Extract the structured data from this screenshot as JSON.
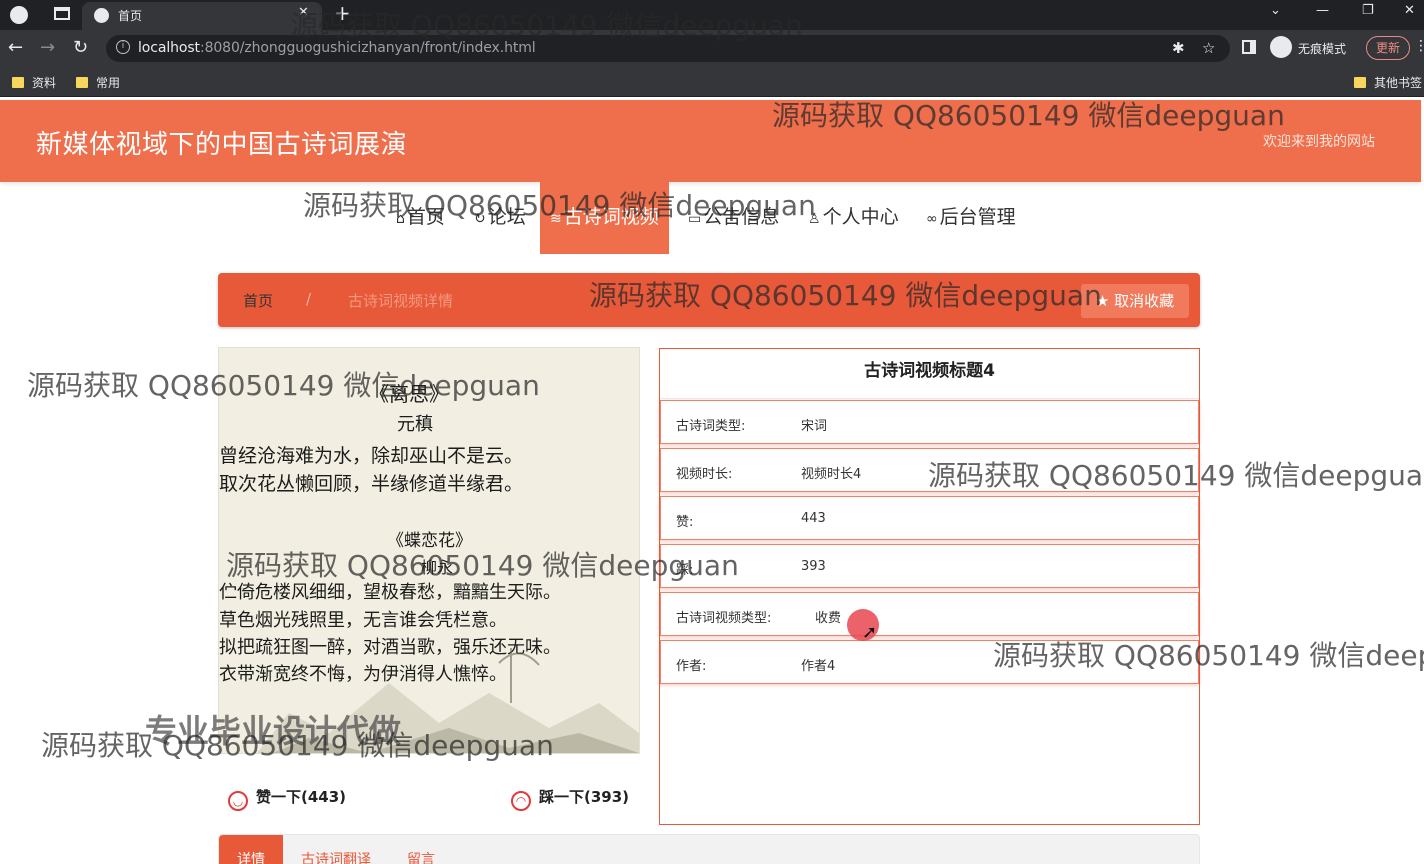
{
  "browser": {
    "tab_title": "首页",
    "url_host": "localhost",
    "url_path": ":8080/zhongguogushicizhanyan/front/index.html",
    "profile_label": "无痕模式",
    "update_label": "更新",
    "bookmarks": [
      "资料",
      "常用"
    ],
    "other_bookmarks": "其他书签"
  },
  "header": {
    "site_title": "新媒体视域下的中国古诗词展演",
    "welcome": "欢迎来到我的网站"
  },
  "nav": [
    {
      "icon": "home-icon",
      "glyph": "⌂",
      "label": "首页"
    },
    {
      "icon": "forum-icon",
      "glyph": "↻",
      "label": "论坛"
    },
    {
      "icon": "layers-icon",
      "glyph": "≋",
      "label": "古诗词视频"
    },
    {
      "icon": "notice-icon",
      "glyph": "▭",
      "label": "公告信息"
    },
    {
      "icon": "user-icon",
      "glyph": "♙",
      "label": "个人中心"
    },
    {
      "icon": "link-icon",
      "glyph": "∞",
      "label": "后台管理"
    }
  ],
  "breadcrumb": {
    "home": "首页",
    "separator": "/",
    "current": "古诗词视频详情"
  },
  "unfavorite_label": "取消收藏",
  "poem": {
    "title1": "《离思》",
    "author1": "元稹",
    "lines1": [
      "曾经沧海难为水，除却巫山不是云。",
      "取次花丛懒回顾，半缘修道半缘君。"
    ],
    "title2": "《蝶恋花》",
    "author2": "柳永",
    "lines2": [
      "伫倚危楼风细细，望极春愁，黯黯生天际。",
      "草色烟光残照里，无言谁会凭栏意。",
      "拟把疏狂图一醉，对酒当歌，强乐还无味。",
      "衣带渐宽终不悔，为伊消得人憔悴。"
    ]
  },
  "actions": {
    "like_label": "赞一下(443)",
    "dislike_label": "踩一下(393)"
  },
  "detail": {
    "title": "古诗词视频标题4",
    "rows": [
      {
        "key": "古诗词类型:",
        "value": "宋词"
      },
      {
        "key": "视频时长:",
        "value": "视频时长4"
      },
      {
        "key": "赞:",
        "value": "443"
      },
      {
        "key": "踩:",
        "value": "393"
      },
      {
        "key": "古诗词视频类型:",
        "value": "收费"
      },
      {
        "key": "作者:",
        "value": "作者4"
      }
    ]
  },
  "bottom_tabs": [
    "详情",
    "古诗词翻译",
    "留言"
  ],
  "watermark_text": "源码获取 QQ86050149 微信deepguan",
  "watermark_big": "专业毕业设计代做",
  "colors": {
    "accent": "#ef6e4c",
    "breadcrumb": "#e8593a",
    "chrome_dark": "#202124"
  }
}
